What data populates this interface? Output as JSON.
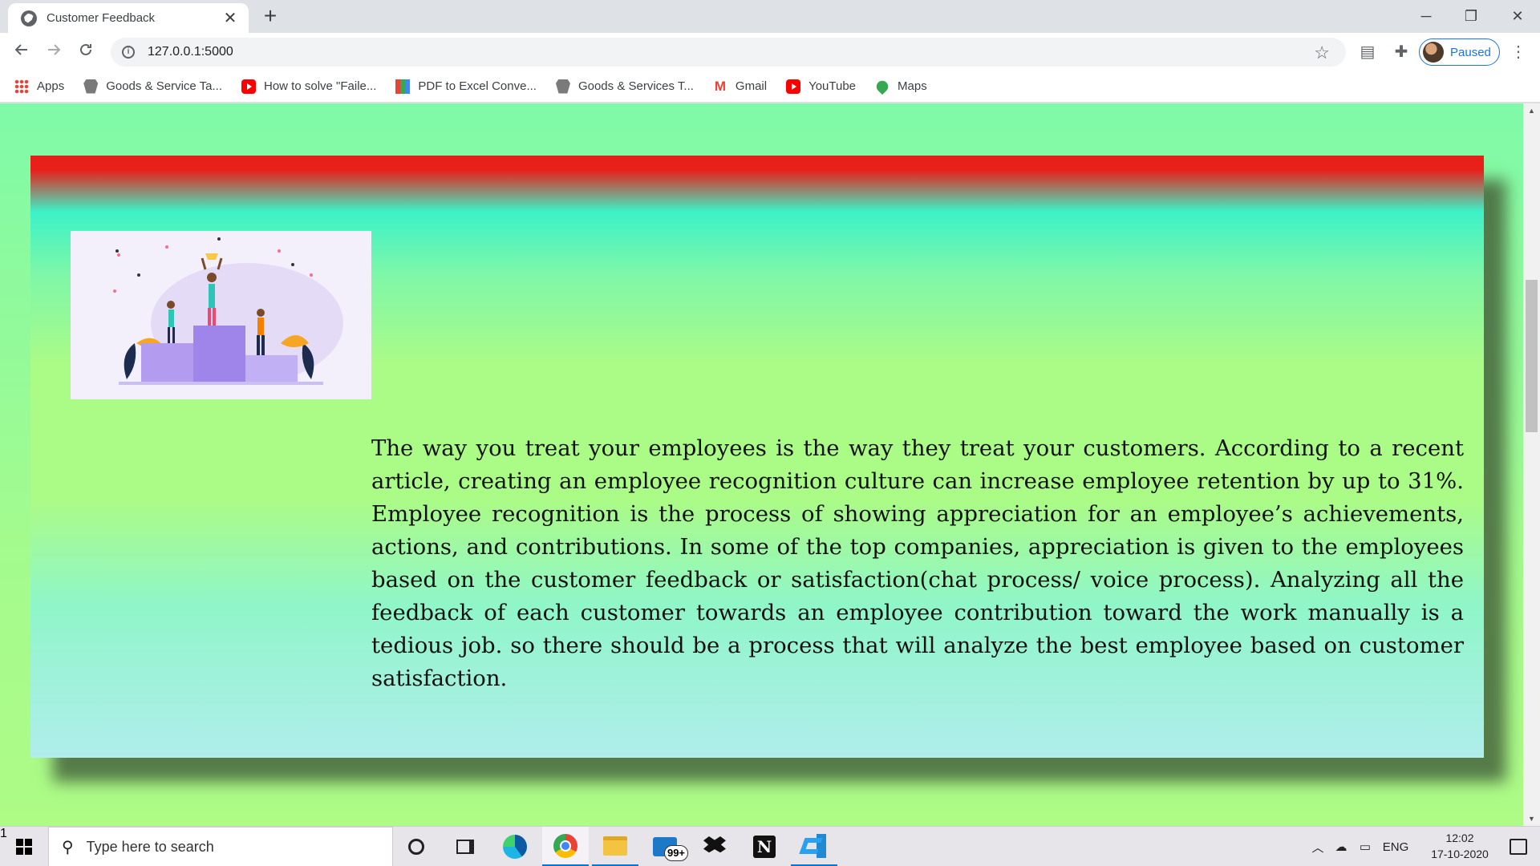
{
  "browser": {
    "tab_title": "Customer Feedback",
    "tab_close_glyph": "✕",
    "new_tab_glyph": "+",
    "window_controls": {
      "minimize": "─",
      "restore": "❐",
      "close": "✕"
    },
    "url": "127.0.0.1:5000",
    "profile_label": "Paused",
    "bookmarks": [
      {
        "label": "Apps",
        "icon": "apps-grid-icon"
      },
      {
        "label": "Goods & Service Ta...",
        "icon": "gst-emblem-icon"
      },
      {
        "label": "How to solve \"Faile...",
        "icon": "youtube-icon"
      },
      {
        "label": "PDF to Excel Conve...",
        "icon": "pdf-converter-icon"
      },
      {
        "label": "Goods & Services T...",
        "icon": "gst-emblem-icon"
      },
      {
        "label": "Gmail",
        "icon": "gmail-icon"
      },
      {
        "label": "YouTube",
        "icon": "youtube-icon"
      },
      {
        "label": "Maps",
        "icon": "maps-pin-icon"
      }
    ]
  },
  "page": {
    "body_text": "The way you treat your employees is the way they treat your customers. According to a recent article, creating an employee recognition culture can increase employee retention by up to 31%. Employee recognition is the process of showing appreciation for an employee’s achievements, actions, and contributions. In some of the top companies, appreciation is given to the employees based on the customer feedback or satisfaction(chat process/ voice process). Analyzing all the feedback of each customer towards an employee contribution toward the work manually is a tedious job. so there should be a process that will analyze the best employee based on customer satisfaction.",
    "colors": {
      "background_green": "#7ffaa8",
      "card_top_red": "#e8201a",
      "card_bottom_aqua": "#b0edec"
    }
  },
  "taskbar": {
    "search_placeholder": "Type here to search",
    "mail_badge": "99+",
    "tray_language": "ENG",
    "clock_time": "12:02",
    "clock_date": "17-10-2020",
    "notification_count": "1"
  }
}
